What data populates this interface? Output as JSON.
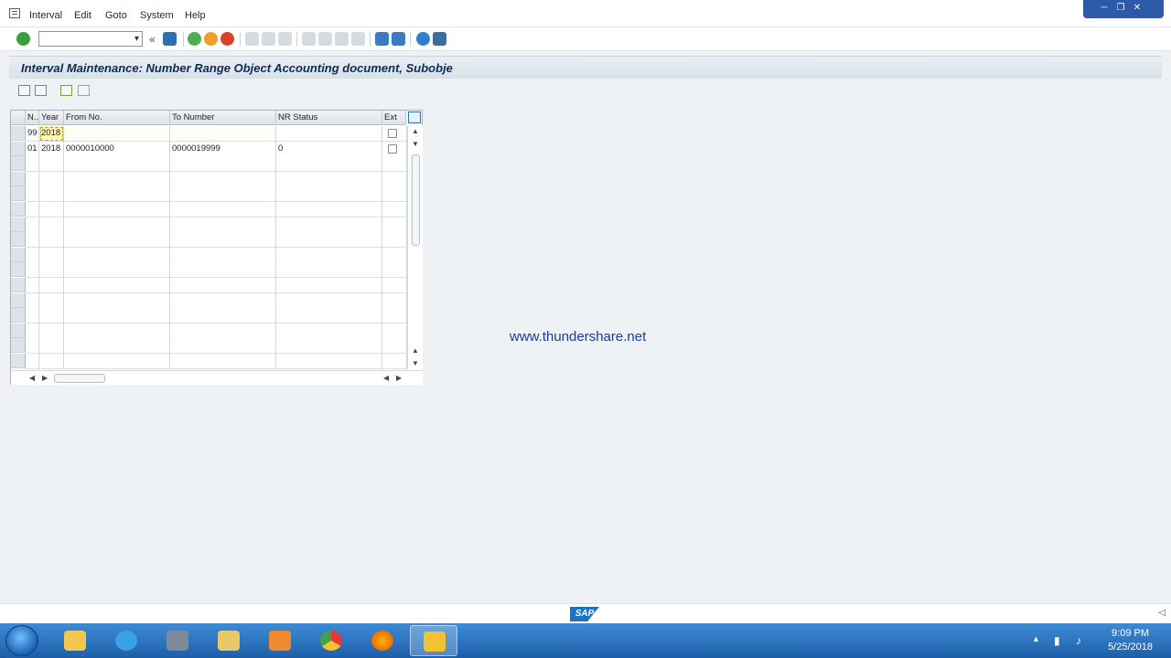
{
  "menu": {
    "items": [
      "Interval",
      "Edit",
      "Goto",
      "System",
      "Help"
    ]
  },
  "window_controls": [
    "─",
    "❐",
    "✕"
  ],
  "toolbar": {
    "command_field_value": "",
    "back_glyph": "«"
  },
  "title": "Interval Maintenance: Number Range Object Accounting document, Subobje",
  "table": {
    "columns": [
      "N..",
      "Year",
      "From No.",
      "To Number",
      "NR Status",
      "Ext"
    ],
    "rows": [
      {
        "no": "99",
        "year": "2018",
        "from": "",
        "to": "",
        "status": "",
        "ext": false
      },
      {
        "no": "01",
        "year": "2018",
        "from": "0000010000",
        "to": "0000019999",
        "status": "0",
        "ext": false
      }
    ]
  },
  "watermark": "www.thundershare.net",
  "status": {
    "logo_text": "SAP"
  },
  "taskbar": {
    "time": "9:09 PM",
    "date": "5/25/2018"
  },
  "colors": {
    "title_text": "#0c2b4e",
    "watermark": "#1a3a9a",
    "taskbar": "#1d5fa8"
  }
}
